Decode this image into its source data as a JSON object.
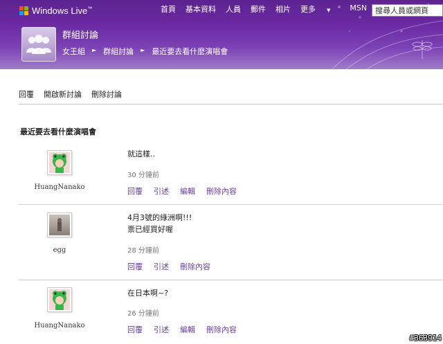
{
  "header": {
    "brand": "Windows Live",
    "brand_tm": "™",
    "nav": [
      "首頁",
      "基本資料",
      "人員",
      "郵件",
      "相片",
      "更多",
      "MSN"
    ],
    "search_placeholder": "搜尋人員或網頁",
    "group_title": "群組討論",
    "breadcrumb": [
      "女王組",
      "群組討論",
      "最近要去看什麼演唱會"
    ],
    "colors": {
      "primary": "#6a2aa2",
      "link": "#6b3fa0"
    }
  },
  "toolbar": {
    "reply": "回覆",
    "new_topic": "開啟新討論",
    "delete_topic": "刪除討論"
  },
  "thread_title": "最近要去看什麼演唱會",
  "posts": [
    {
      "author": "HuangNanako",
      "avatar_icon": "green-frog-hood-avatar",
      "lines": [
        "就這樣.."
      ],
      "time": "30 分鐘前",
      "actions": [
        "回覆",
        "引述",
        "編輯",
        "刪除內容"
      ]
    },
    {
      "author": "egg",
      "avatar_icon": "photo-avatar",
      "lines": [
        "4月3號的綠洲啊!!!",
        "票已經買好喔"
      ],
      "time": "28 分鐘前",
      "actions": [
        "回覆",
        "引述",
        "刪除內容"
      ]
    },
    {
      "author": "HuangNanako",
      "avatar_icon": "green-frog-hood-avatar",
      "lines": [
        "在日本啊~?"
      ],
      "time": "26 分鐘前",
      "actions": [
        "回覆",
        "引述",
        "編輯",
        "刪除內容"
      ]
    }
  ],
  "watermark": "#363914"
}
